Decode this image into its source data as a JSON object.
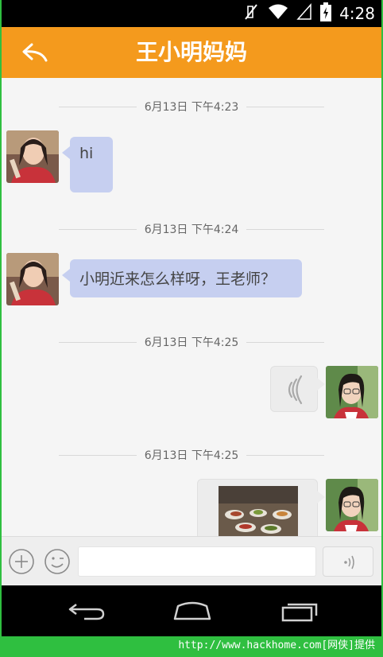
{
  "status_bar": {
    "time": "4:28",
    "icons": [
      "mute-icon",
      "wifi-icon",
      "signal-icon",
      "battery-charging-icon"
    ]
  },
  "header": {
    "title": "王小明妈妈",
    "back_icon": "back-arrow-icon"
  },
  "messages": [
    {
      "timestamp": "6月13日 下午4:23",
      "direction": "incoming",
      "type": "text",
      "text": "hi"
    },
    {
      "timestamp": "6月13日 下午4:24",
      "direction": "incoming",
      "type": "text",
      "text": "小明近来怎么样呀，王老师？"
    },
    {
      "timestamp": "6月13日 下午4:25",
      "direction": "outgoing",
      "type": "voice",
      "icon": "voice-wave-icon"
    },
    {
      "timestamp": "6月13日 下午4:25",
      "direction": "outgoing",
      "type": "image",
      "icon": "photo-thumbnail"
    }
  ],
  "input_bar": {
    "add_icon": "plus-circle-icon",
    "emoji_icon": "emoji-icon",
    "text_value": "",
    "voice_icon": "voice-input-icon"
  },
  "nav_bar": {
    "buttons": [
      "back-nav-icon",
      "home-nav-icon",
      "recents-nav-icon"
    ]
  },
  "footer": {
    "watermark": "http://www.hackhome.com[网侠]提供"
  },
  "colors": {
    "header": "#f49a1d",
    "incoming_bubble": "#c6cff0",
    "outgoing_bubble": "#ececec",
    "chat_background": "#f5f5f5",
    "frame_border": "#2fbf40"
  }
}
